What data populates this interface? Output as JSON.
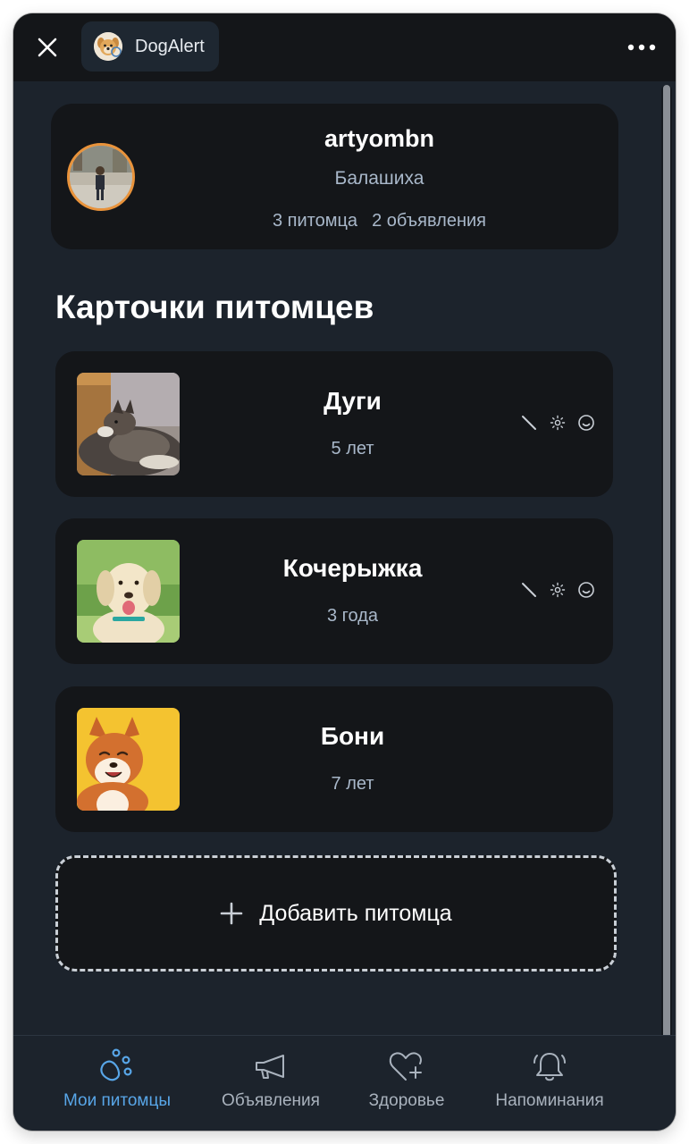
{
  "window": {
    "app_name": "DogAlert"
  },
  "profile": {
    "username": "artyombn",
    "city": "Балашиха",
    "pets_count": "3 питомца",
    "ads_count": "2 объявления"
  },
  "section_title": "Карточки питомцев",
  "pets": [
    {
      "name": "Дуги",
      "age": "5 лет",
      "photo": "brindle-dog-photo",
      "show_icons": true
    },
    {
      "name": "Кочерыжка",
      "age": "3 года",
      "photo": "labrador-photo",
      "show_icons": true
    },
    {
      "name": "Бони",
      "age": "7 лет",
      "photo": "shiba-inu-photo",
      "show_icons": false
    }
  ],
  "pet_card_icons": [
    "edit-slash-icon",
    "sun-icon",
    "smile-icon"
  ],
  "add_pet": {
    "label": "Добавить питомца"
  },
  "tabs": [
    {
      "label": "Мои питомцы",
      "icon": "paw-icon",
      "active": true
    },
    {
      "label": "Объявления",
      "icon": "megaphone-icon",
      "active": false
    },
    {
      "label": "Здоровье",
      "icon": "heart-plus-icon",
      "active": false
    },
    {
      "label": "Напоминания",
      "icon": "bell-icon",
      "active": false
    }
  ],
  "colors": {
    "accent": "#58a6e8",
    "background": "#1c232c",
    "card": "#141619",
    "avatar_ring": "#e9933b"
  }
}
